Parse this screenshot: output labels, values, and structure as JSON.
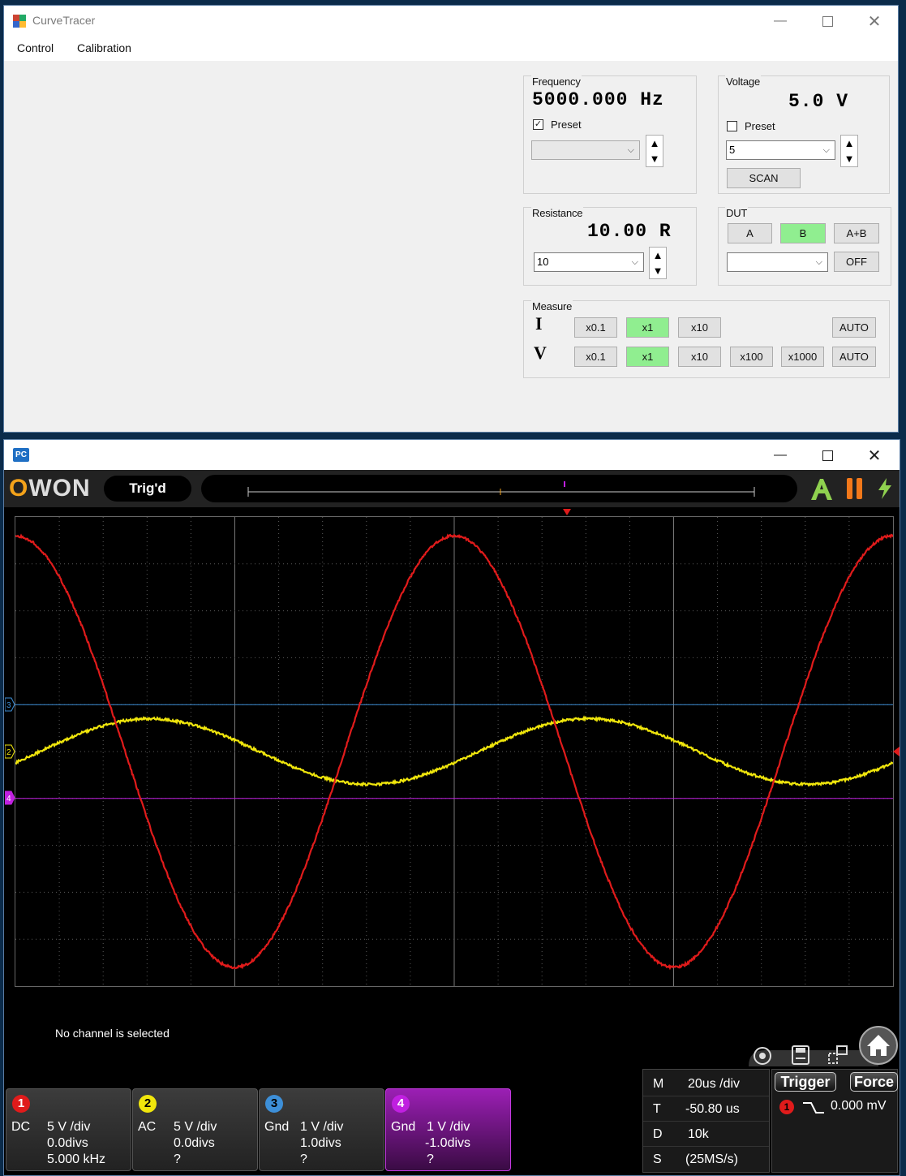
{
  "curve_tracer": {
    "title": "CurveTracer",
    "menu": [
      "Control",
      "Calibration"
    ],
    "frequency": {
      "label": "Frequency",
      "value": "5000.000 Hz",
      "preset_label": "Preset",
      "preset_checked": true,
      "combo_value": ""
    },
    "voltage": {
      "label": "Voltage",
      "value": "5.0 V",
      "preset_label": "Preset",
      "preset_checked": false,
      "combo_value": "5",
      "scan_label": "SCAN"
    },
    "resistance": {
      "label": "Resistance",
      "value": "10.00 R",
      "combo_value": "10"
    },
    "dut": {
      "label": "DUT",
      "buttons": [
        "A",
        "B",
        "A+B"
      ],
      "active": "B",
      "combo_value": "",
      "off_label": "OFF"
    },
    "measure": {
      "label": "Measure",
      "i_label": "I",
      "v_label": "V",
      "i_buttons": [
        "x0.1",
        "x1",
        "x10",
        "AUTO"
      ],
      "v_buttons": [
        "x0.1",
        "x1",
        "x10",
        "x100",
        "x1000",
        "AUTO"
      ],
      "i_active": "x1",
      "v_active": "x1"
    },
    "spin_up": "▲",
    "spin_down": "▼"
  },
  "scope": {
    "brand": "OWON",
    "trig_status": "Trig'd",
    "app_icon_text": "PC",
    "status_message": "No channel is selected",
    "channels": [
      {
        "num": "1",
        "coupling": "DC",
        "vdiv": "5 V /div",
        "offset": "0.0divs",
        "measure": "5.000 kHz",
        "color": "#e01b1b",
        "selected": false
      },
      {
        "num": "2",
        "coupling": "AC",
        "vdiv": "5 V /div",
        "offset": "0.0divs",
        "measure": "?",
        "color": "#f0e60c",
        "selected": false
      },
      {
        "num": "3",
        "coupling": "Gnd",
        "vdiv": "1 V /div",
        "offset": "1.0divs",
        "measure": "?",
        "color": "#3d8fd8",
        "selected": false
      },
      {
        "num": "4",
        "coupling": "Gnd",
        "vdiv": "1 V /div",
        "offset": "-1.0divs",
        "measure": "?",
        "color": "#c020e0",
        "selected": true
      }
    ],
    "timebase": [
      {
        "key": "M",
        "value": "20us /div"
      },
      {
        "key": "T",
        "value": "-50.80 us"
      },
      {
        "key": "D",
        "value": "10k"
      },
      {
        "key": "S",
        "value": "(25MS/s)"
      }
    ],
    "trigger_label": "Trigger",
    "force_label": "Force",
    "trigger_source": "1",
    "trigger_level": "0.000 mV",
    "marker_ch2": "2",
    "marker_ch3": "3",
    "marker_ch4": "4",
    "waveforms": {
      "ch1": {
        "amplitude_divs": 4.6,
        "offset_divs": 0,
        "period_us": 200,
        "phase_deg": 90
      },
      "ch2": {
        "amplitude_divs": 0.7,
        "offset_divs": 0,
        "period_us": 200,
        "phase_deg": -20
      }
    },
    "colors": {
      "accent": "#f3a21a",
      "grid": "#5a5a5a"
    }
  }
}
